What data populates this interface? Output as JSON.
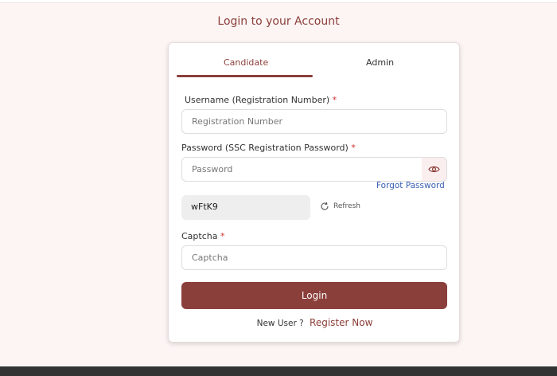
{
  "page": {
    "heading": "Login to your Account"
  },
  "tabs": [
    {
      "label": "Candidate",
      "active": true
    },
    {
      "label": "Admin",
      "active": false
    }
  ],
  "form": {
    "username_label": "Username (Registration Number)",
    "username_placeholder": "Registration Number",
    "password_label": "Password (SSC Registration Password)",
    "password_placeholder": "Password",
    "forgot_password": "Forgot Password",
    "captcha_code": "wFtK9",
    "refresh_label": "Refresh",
    "captcha_label": "Captcha",
    "captcha_placeholder": "Captcha",
    "required_mark": "*",
    "login_button": "Login"
  },
  "register": {
    "prompt": "New User ?",
    "link": "Register Now"
  },
  "colors": {
    "accent": "#8b3f3a",
    "link": "#3b5fb5",
    "required": "#d0312d",
    "background": "#fcf5f4"
  },
  "icons": {
    "password_toggle": "eye-icon",
    "refresh": "refresh-icon"
  }
}
